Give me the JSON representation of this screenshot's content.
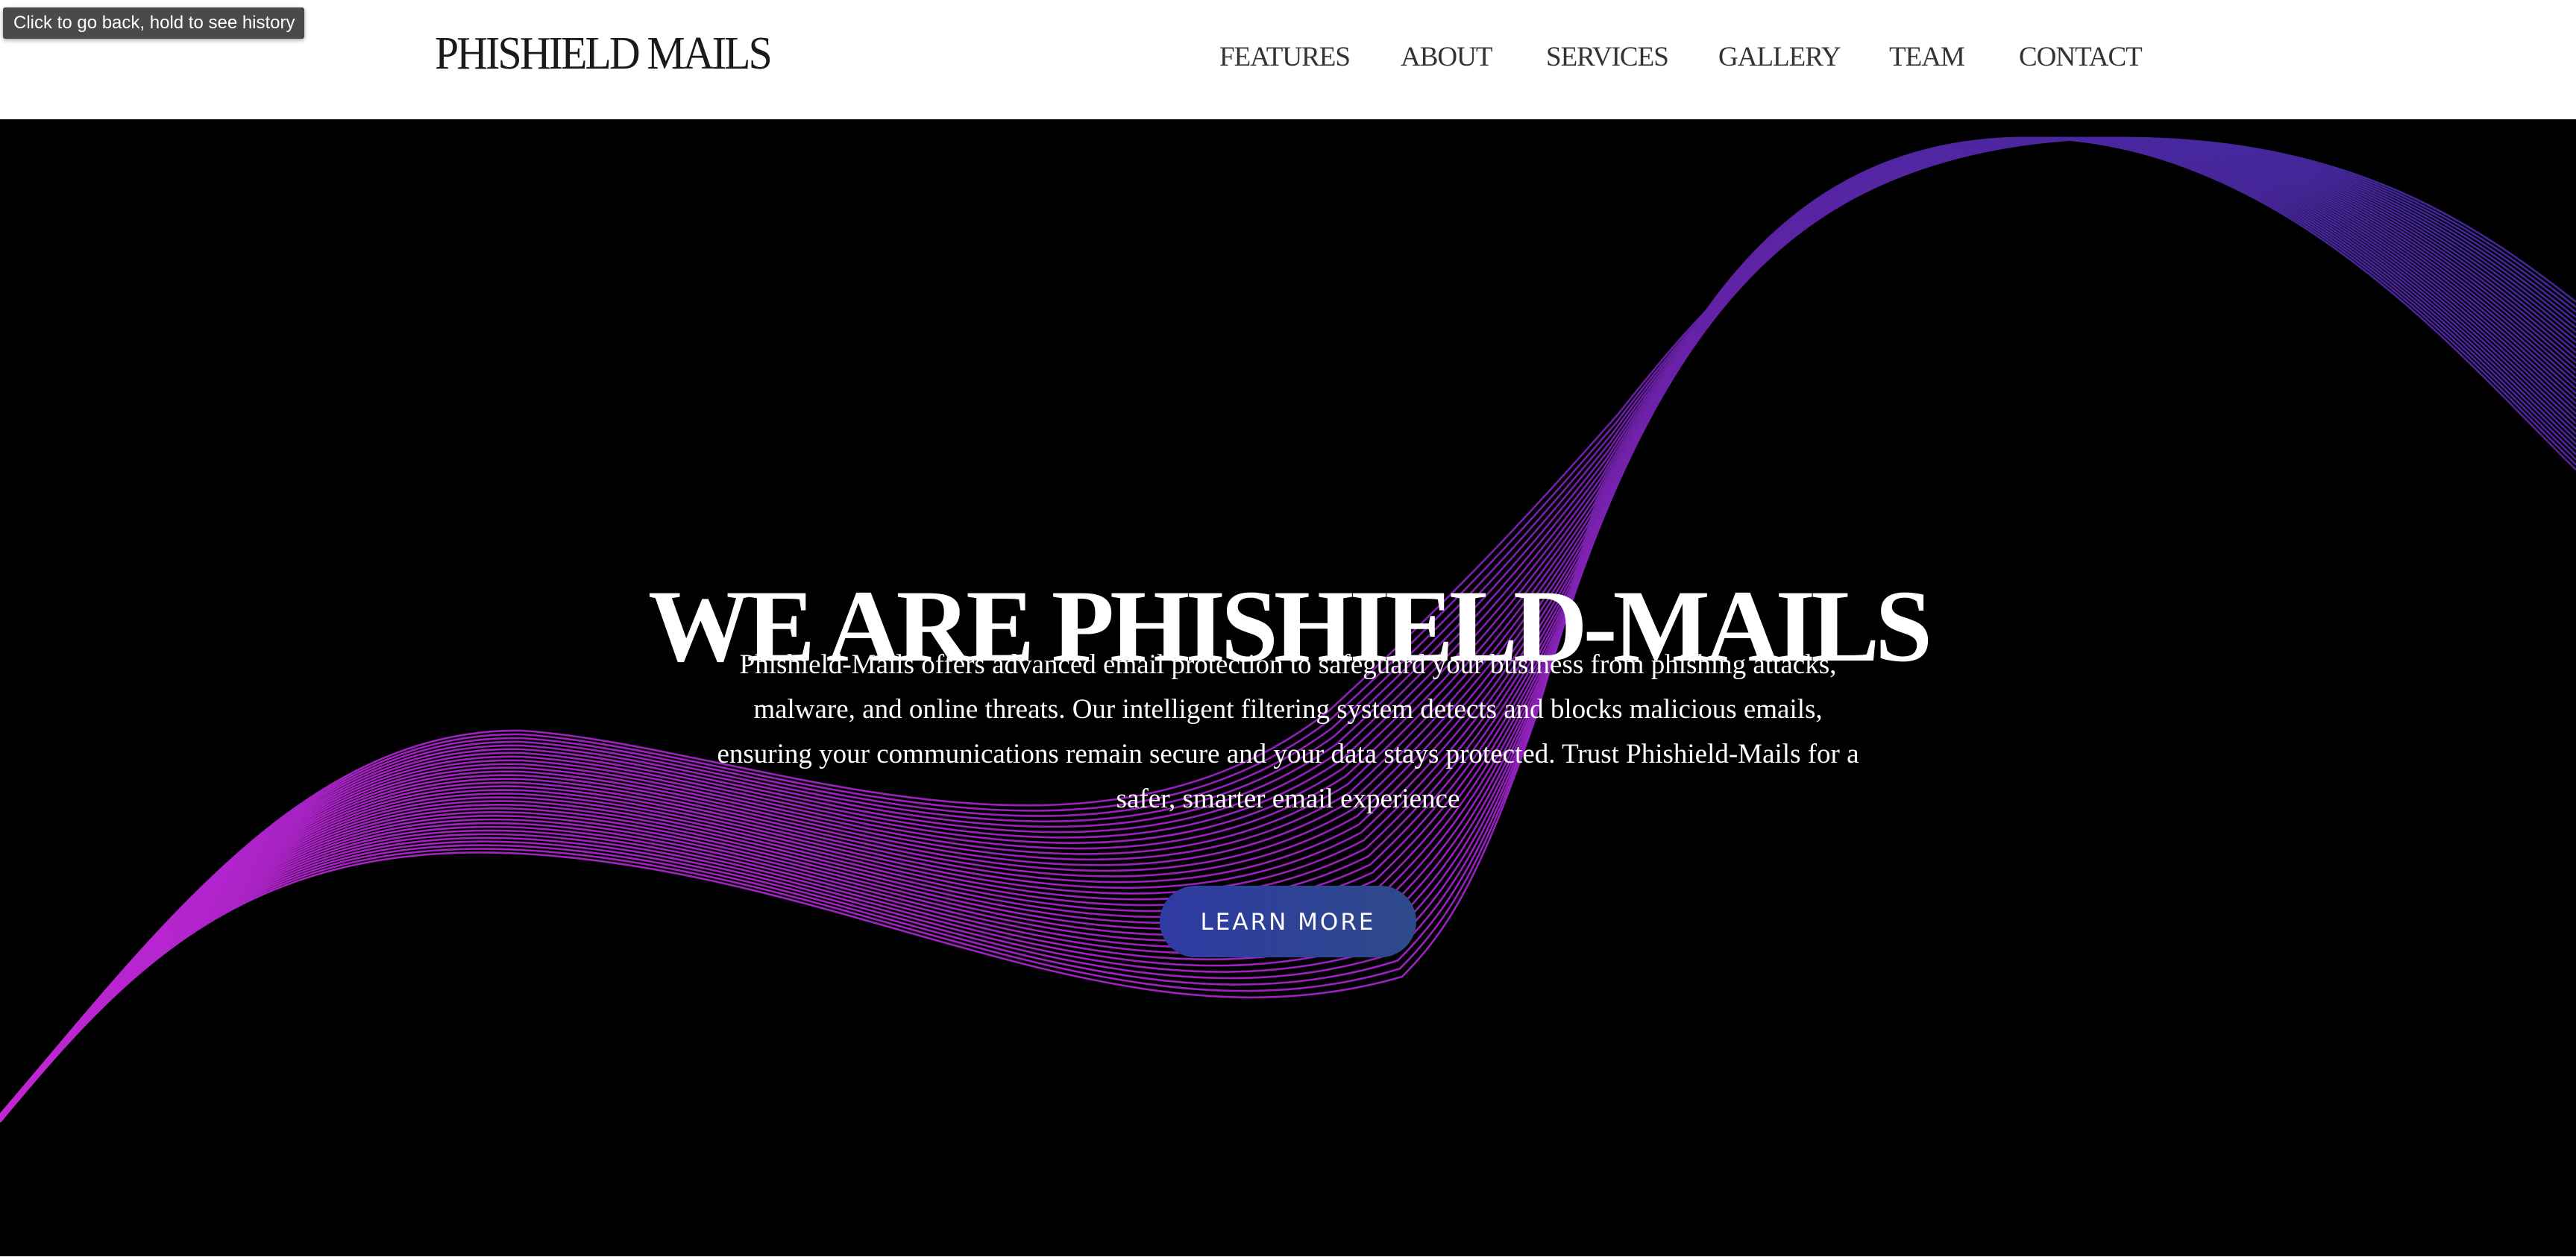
{
  "tooltip": {
    "text": "Click to go back, hold to see history"
  },
  "header": {
    "logo": "PHISHIELD MAILS",
    "nav": [
      {
        "label": "FEATURES"
      },
      {
        "label": "ABOUT"
      },
      {
        "label": "SERVICES"
      },
      {
        "label": "GALLERY"
      },
      {
        "label": "TEAM"
      },
      {
        "label": "CONTACT"
      }
    ]
  },
  "hero": {
    "title": "WE ARE PHISHIELD-MAILS",
    "description": "Phishield-Mails offers advanced email protection to safeguard your business from phishing attacks, malware, and online threats. Our intelligent filtering system detects and blocks malicious emails, ensuring your communications remain secure and your data stays protected. Trust Phishield-Mails for a safer, smarter email experience",
    "cta_label": "LEARN MORE"
  },
  "colors": {
    "hero_background": "#000000",
    "wave_magenta": "#b020c8",
    "wave_purple": "#6a24b8",
    "wave_indigo": "#3a2a9a",
    "cta_start": "#2f3aa3",
    "cta_end": "#2e4a8a"
  }
}
